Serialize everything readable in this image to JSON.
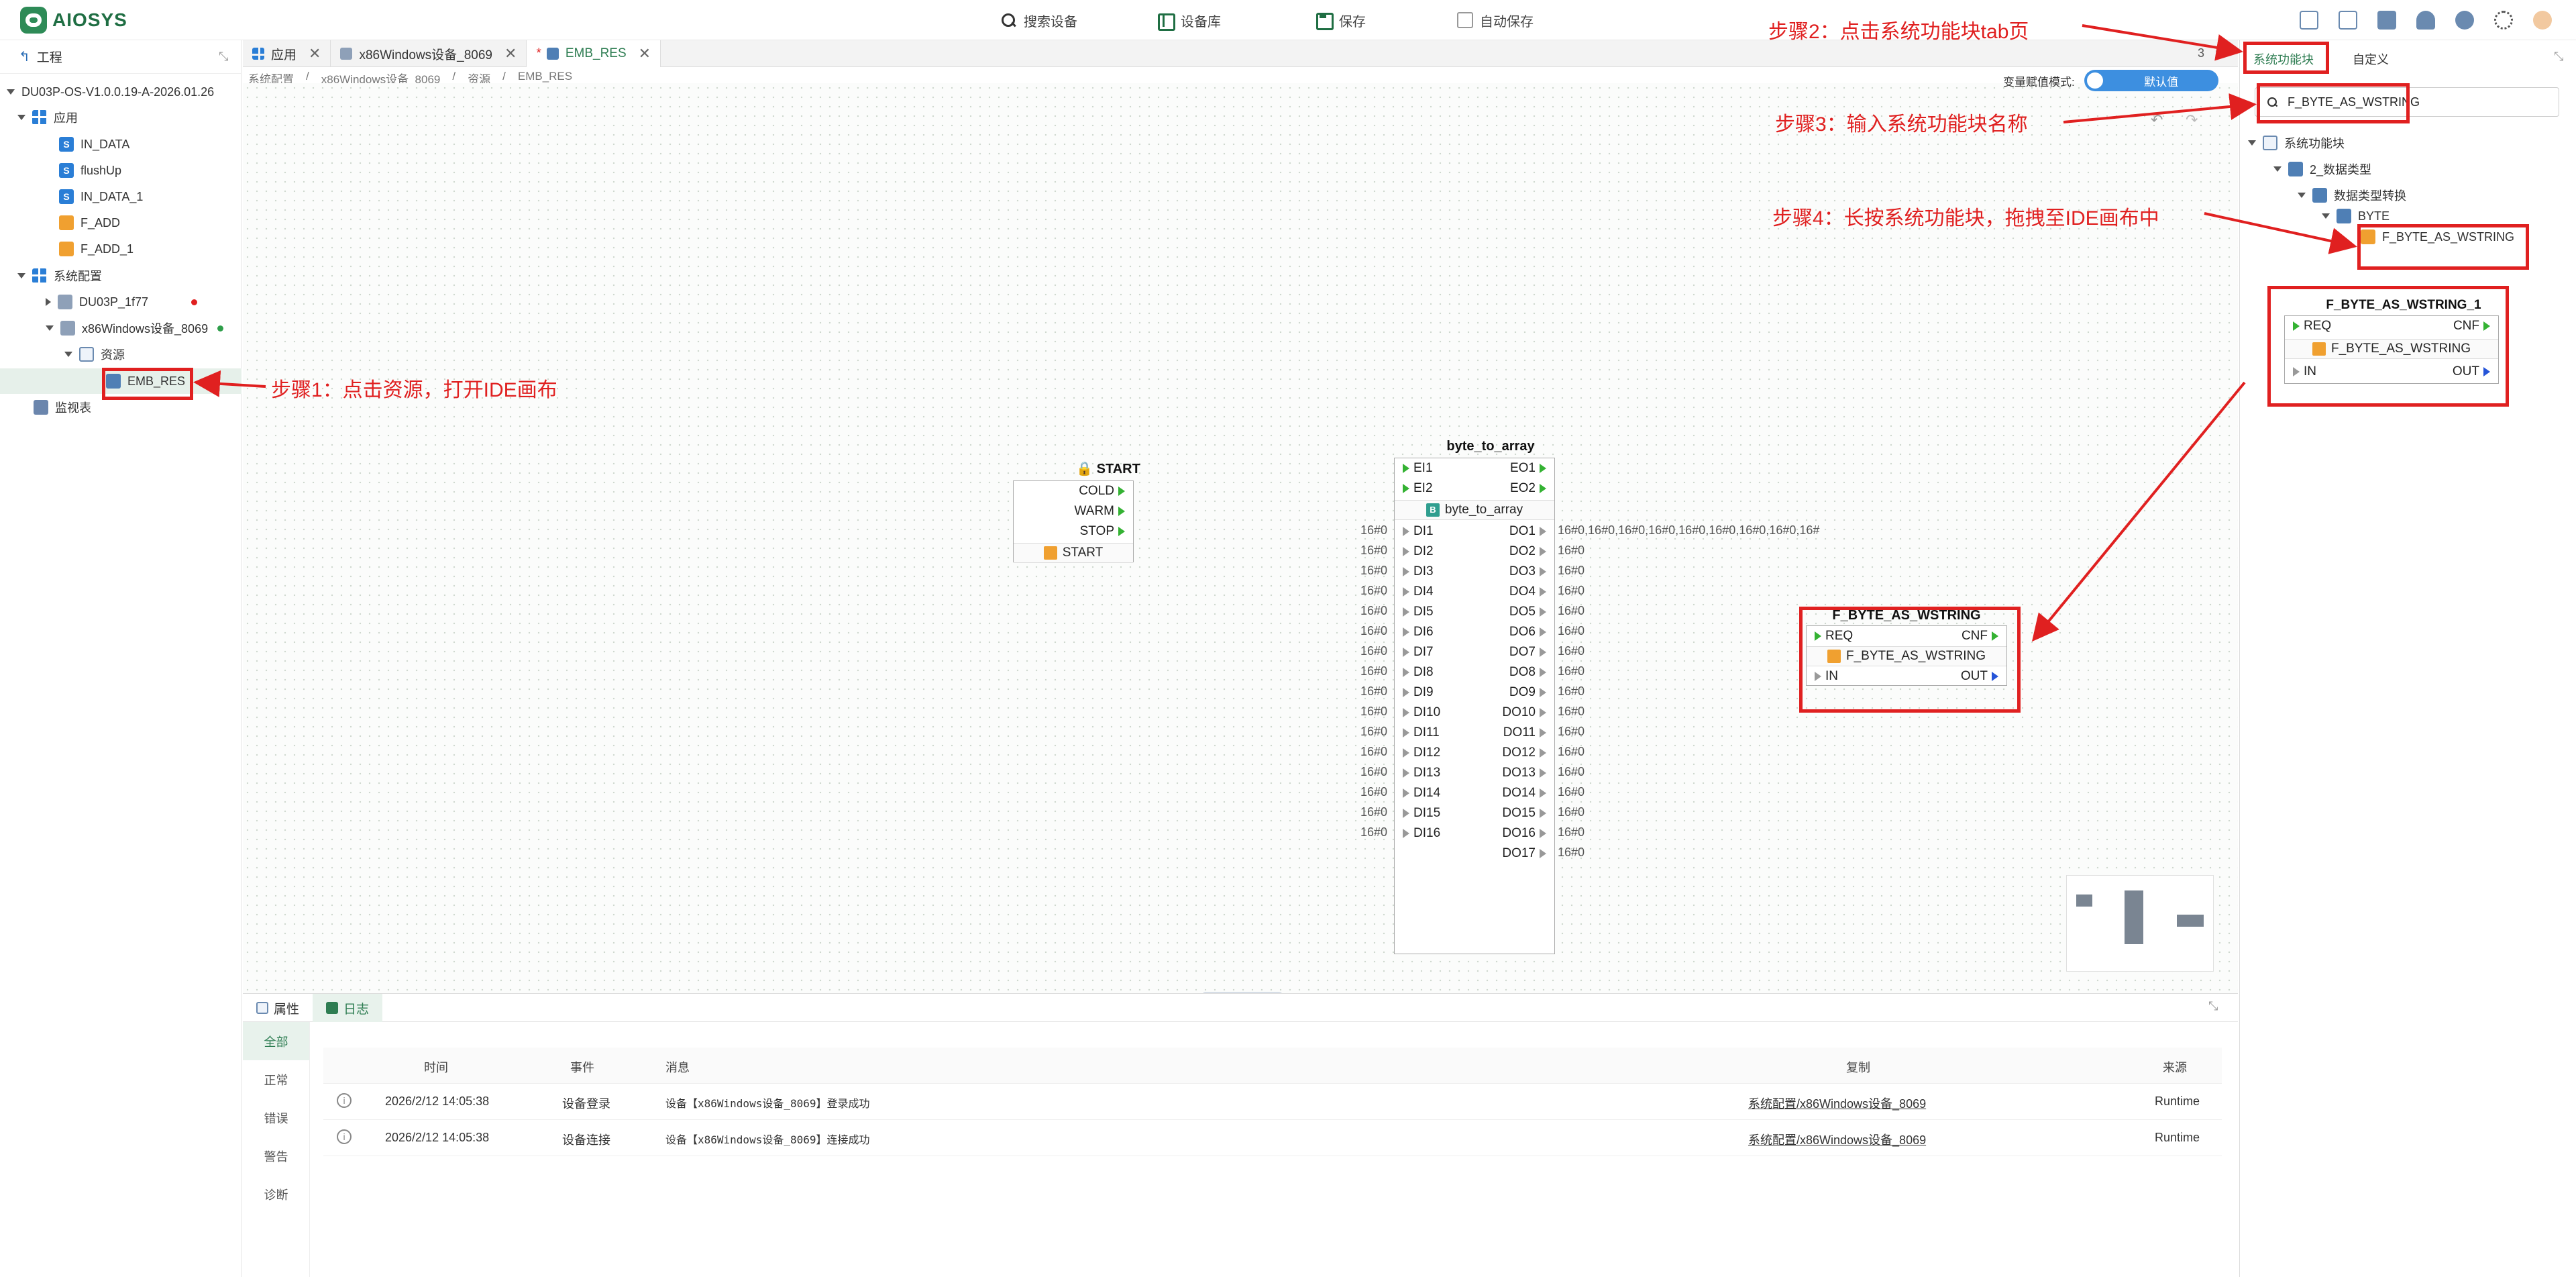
{
  "app": {
    "logo_text": "AIOSYS"
  },
  "toolbar": {
    "search_label": "搜索设备",
    "library_label": "设备库",
    "save_label": "保存",
    "autosave_label": "自动保存"
  },
  "project": {
    "header": "工程",
    "root": "DU03P-OS-V1.0.0.19-A-2026.01.26",
    "app_label": "应用",
    "items": [
      "IN_DATA",
      "flushUp",
      "IN_DATA_1",
      "F_ADD",
      "F_ADD_1"
    ],
    "sysconfig_label": "系统配置",
    "device1": "DU03P_1f77",
    "device2": "x86Windows设备_8069",
    "resource_label": "资源",
    "resource_item": "EMB_RES",
    "monitor_label": "监视表"
  },
  "tabs": [
    {
      "label": "应用"
    },
    {
      "label": "x86Windows设备_8069"
    },
    {
      "label": "EMB_RES"
    }
  ],
  "tab_modified_mark": "*",
  "tabs_overflow_count": "3",
  "breadcrumb": [
    "系统配置",
    "/",
    "x86Windows设备_8069",
    "/",
    "资源",
    "/",
    "EMB_RES"
  ],
  "mode": {
    "label": "变量赋值模式:",
    "value": "默认值"
  },
  "start_block": {
    "title": "START",
    "outputs": [
      "COLD",
      "WARM",
      "STOP"
    ],
    "type": "START"
  },
  "bta_block": {
    "title": "byte_to_array",
    "events_in": [
      "EI1",
      "EI2"
    ],
    "events_out": [
      "EO1",
      "EO2"
    ],
    "type": "byte_to_array",
    "data_in": [
      "DI1",
      "DI2",
      "DI3",
      "DI4",
      "DI5",
      "DI6",
      "DI7",
      "DI8",
      "DI9",
      "DI10",
      "DI11",
      "DI12",
      "DI13",
      "DI14",
      "DI15",
      "DI16"
    ],
    "data_out": [
      "DO1",
      "DO2",
      "DO3",
      "DO4",
      "DO5",
      "DO6",
      "DO7",
      "DO8",
      "DO9",
      "DO10",
      "DO11",
      "DO12",
      "DO13",
      "DO14",
      "DO15",
      "DO16",
      "DO17"
    ],
    "in_value": "16#0",
    "out_value": "16#0",
    "do1_value": "16#0,16#0,16#0,16#0,16#0,16#0,16#0,16#0,16#"
  },
  "fb_canvas": {
    "title": "F_BYTE_AS_WSTRING",
    "req": "REQ",
    "cnf": "CNF",
    "type": "F_BYTE_AS_WSTRING",
    "in": "IN",
    "out": "OUT"
  },
  "fb_preview": {
    "title": "F_BYTE_AS_WSTRING_1",
    "req": "REQ",
    "cnf": "CNF",
    "type": "F_BYTE_AS_WSTRING",
    "in": "IN",
    "out": "OUT"
  },
  "right": {
    "tab1": "系统功能块",
    "tab2": "自定义",
    "search_value": "F_BYTE_AS_WSTRING",
    "tree": [
      "系统功能块",
      "2_数据类型",
      "数据类型转换",
      "BYTE",
      "F_BYTE_AS_WSTRING"
    ]
  },
  "annotations": {
    "step1": "步骤1：点击资源，打开IDE画布",
    "step2": "步骤2：点击系统功能块tab页",
    "step3": "步骤3：输入系统功能块名称",
    "step4": "步骤4：长按系统功能块，拖拽至IDE画布中"
  },
  "bottom": {
    "tab_props": "属性",
    "tab_log": "日志",
    "filters": [
      "全部",
      "正常",
      "错误",
      "警告",
      "诊断"
    ],
    "headers": {
      "time": "时间",
      "event": "事件",
      "message": "消息",
      "copy": "复制",
      "source": "来源"
    },
    "rows": [
      {
        "time": "2026/2/12 14:05:38",
        "event": "设备登录",
        "message": "设备【x86Windows设备_8069】登录成功",
        "copy": "系统配置/x86Windows设备_8069",
        "source": "Runtime"
      },
      {
        "time": "2026/2/12 14:05:38",
        "event": "设备连接",
        "message": "设备【x86Windows设备_8069】连接成功",
        "copy": "系统配置/x86Windows设备_8069",
        "source": "Runtime"
      }
    ]
  },
  "colors": {
    "accent": "#2e7d52",
    "annotation_red": "#e02020",
    "event_pin": "#34b233",
    "toggle_blue": "#3d8fe0"
  }
}
